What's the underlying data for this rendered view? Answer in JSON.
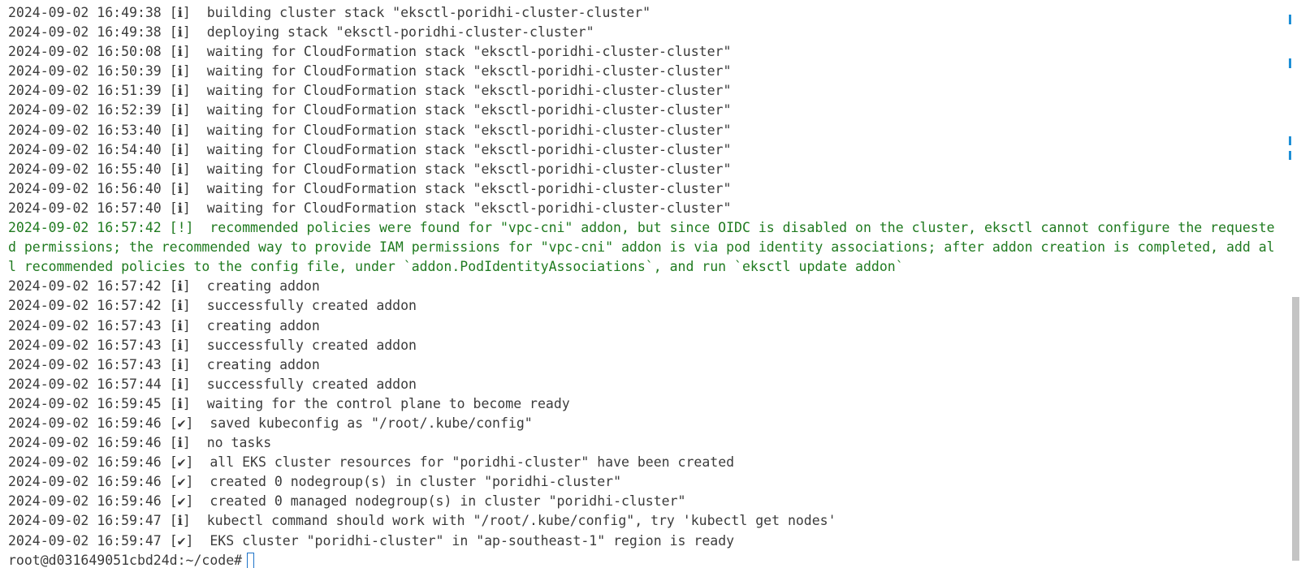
{
  "terminal": {
    "top_fragment": ")",
    "lines": [
      {
        "ts": "2024-09-02 16:49:38",
        "tag": "[ℹ]",
        "msg": "building cluster stack \"eksctl-poridhi-cluster-cluster\""
      },
      {
        "ts": "2024-09-02 16:49:38",
        "tag": "[ℹ]",
        "msg": "deploying stack \"eksctl-poridhi-cluster-cluster\""
      },
      {
        "ts": "2024-09-02 16:50:08",
        "tag": "[ℹ]",
        "msg": "waiting for CloudFormation stack \"eksctl-poridhi-cluster-cluster\""
      },
      {
        "ts": "2024-09-02 16:50:39",
        "tag": "[ℹ]",
        "msg": "waiting for CloudFormation stack \"eksctl-poridhi-cluster-cluster\""
      },
      {
        "ts": "2024-09-02 16:51:39",
        "tag": "[ℹ]",
        "msg": "waiting for CloudFormation stack \"eksctl-poridhi-cluster-cluster\""
      },
      {
        "ts": "2024-09-02 16:52:39",
        "tag": "[ℹ]",
        "msg": "waiting for CloudFormation stack \"eksctl-poridhi-cluster-cluster\""
      },
      {
        "ts": "2024-09-02 16:53:40",
        "tag": "[ℹ]",
        "msg": "waiting for CloudFormation stack \"eksctl-poridhi-cluster-cluster\""
      },
      {
        "ts": "2024-09-02 16:54:40",
        "tag": "[ℹ]",
        "msg": "waiting for CloudFormation stack \"eksctl-poridhi-cluster-cluster\""
      },
      {
        "ts": "2024-09-02 16:55:40",
        "tag": "[ℹ]",
        "msg": "waiting for CloudFormation stack \"eksctl-poridhi-cluster-cluster\""
      },
      {
        "ts": "2024-09-02 16:56:40",
        "tag": "[ℹ]",
        "msg": "waiting for CloudFormation stack \"eksctl-poridhi-cluster-cluster\""
      },
      {
        "ts": "2024-09-02 16:57:40",
        "tag": "[ℹ]",
        "msg": "waiting for CloudFormation stack \"eksctl-poridhi-cluster-cluster\""
      }
    ],
    "warning": {
      "line1": "2024-09-02 16:57:42 [!]  recommended policies were found for \"vpc-cni\" addon, but since OIDC is disabled on the cluster, eksctl cannot configure the requeste",
      "line2": "d permissions; the recommended way to provide IAM permissions for \"vpc-cni\" addon is via pod identity associations; after addon creation is completed, add al",
      "line3": "l recommended policies to the config file, under `addon.PodIdentityAssociations`, and run `eksctl update addon`",
      "color": "#1f7a1f"
    },
    "lines_after": [
      {
        "ts": "2024-09-02 16:57:42",
        "tag": "[ℹ]",
        "msg": "creating addon"
      },
      {
        "ts": "2024-09-02 16:57:42",
        "tag": "[ℹ]",
        "msg": "successfully created addon"
      },
      {
        "ts": "2024-09-02 16:57:43",
        "tag": "[ℹ]",
        "msg": "creating addon"
      },
      {
        "ts": "2024-09-02 16:57:43",
        "tag": "[ℹ]",
        "msg": "successfully created addon"
      },
      {
        "ts": "2024-09-02 16:57:43",
        "tag": "[ℹ]",
        "msg": "creating addon"
      },
      {
        "ts": "2024-09-02 16:57:44",
        "tag": "[ℹ]",
        "msg": "successfully created addon"
      },
      {
        "ts": "2024-09-02 16:59:45",
        "tag": "[ℹ]",
        "msg": "waiting for the control plane to become ready"
      },
      {
        "ts": "2024-09-02 16:59:46",
        "tag": "[✔]",
        "msg": "saved kubeconfig as \"/root/.kube/config\""
      },
      {
        "ts": "2024-09-02 16:59:46",
        "tag": "[ℹ]",
        "msg": "no tasks"
      },
      {
        "ts": "2024-09-02 16:59:46",
        "tag": "[✔]",
        "msg": "all EKS cluster resources for \"poridhi-cluster\" have been created"
      },
      {
        "ts": "2024-09-02 16:59:46",
        "tag": "[✔]",
        "msg": "created 0 nodegroup(s) in cluster \"poridhi-cluster\""
      },
      {
        "ts": "2024-09-02 16:59:46",
        "tag": "[✔]",
        "msg": "created 0 managed nodegroup(s) in cluster \"poridhi-cluster\""
      },
      {
        "ts": "2024-09-02 16:59:47",
        "tag": "[ℹ]",
        "msg": "kubectl command should work with \"/root/.kube/config\", try 'kubectl get nodes'"
      },
      {
        "ts": "2024-09-02 16:59:47",
        "tag": "[✔]",
        "msg": "EKS cluster \"poridhi-cluster\" in \"ap-southeast-1\" region is ready"
      }
    ],
    "prompt": "root@d031649051cbd24d:~/code#",
    "text_color": "#3b3b3b",
    "accent_color": "#1e73c8"
  }
}
